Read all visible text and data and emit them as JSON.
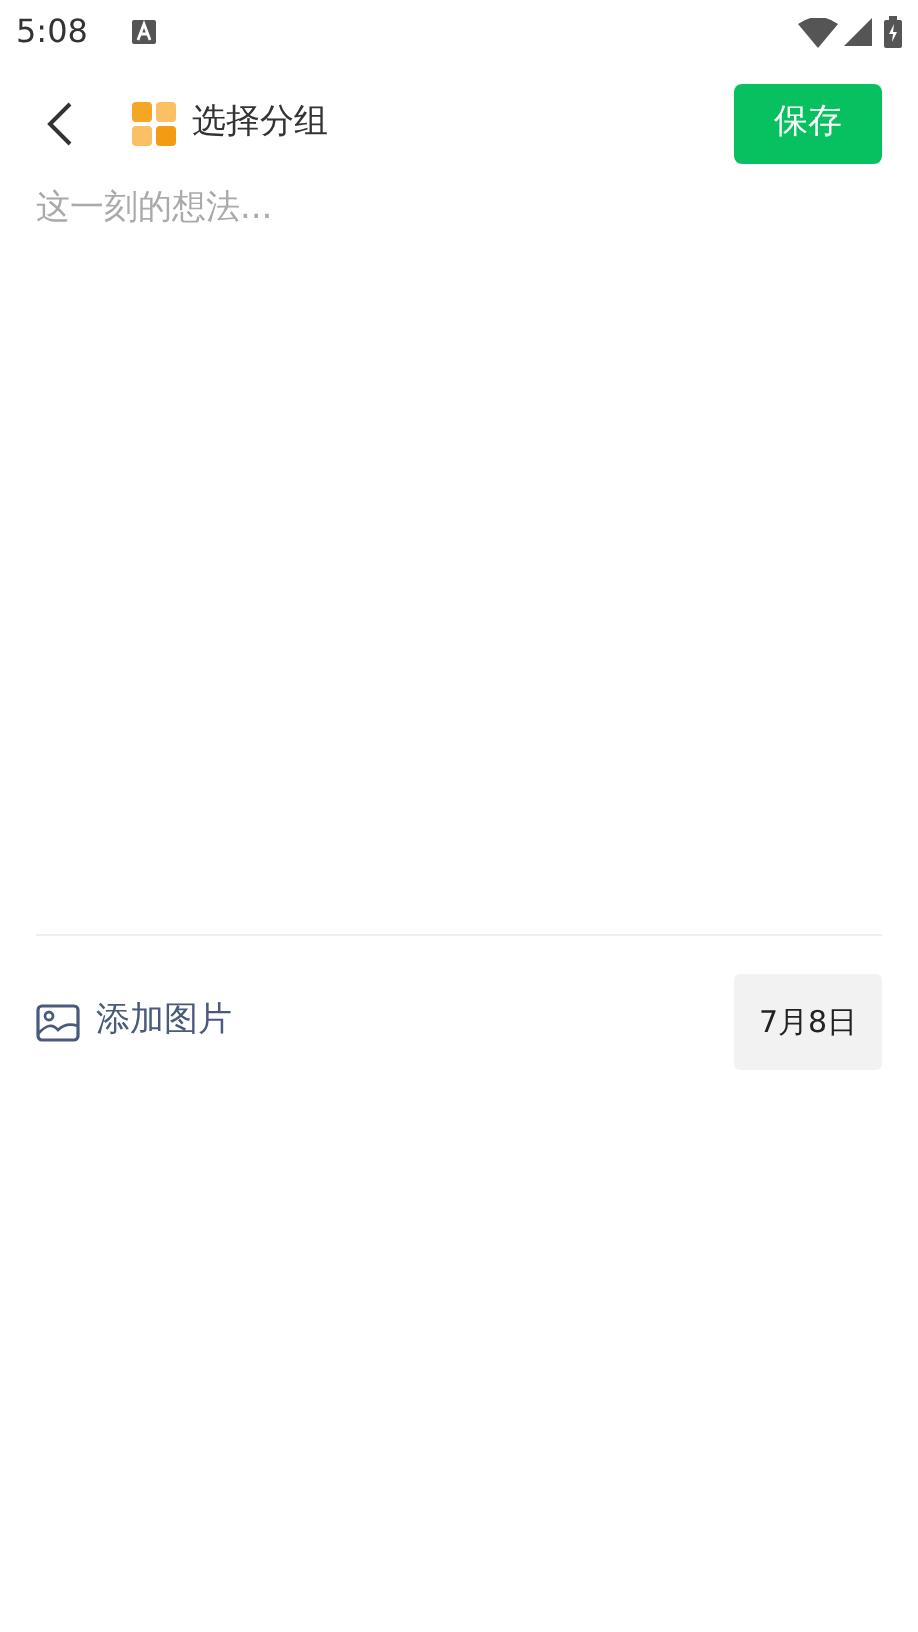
{
  "status_bar": {
    "time": "5:08"
  },
  "header": {
    "group_label": "选择分组",
    "save_button": "保存"
  },
  "editor": {
    "placeholder": "这一刻的想法..."
  },
  "footer": {
    "add_image": "添加图片",
    "date": "7月8日"
  }
}
